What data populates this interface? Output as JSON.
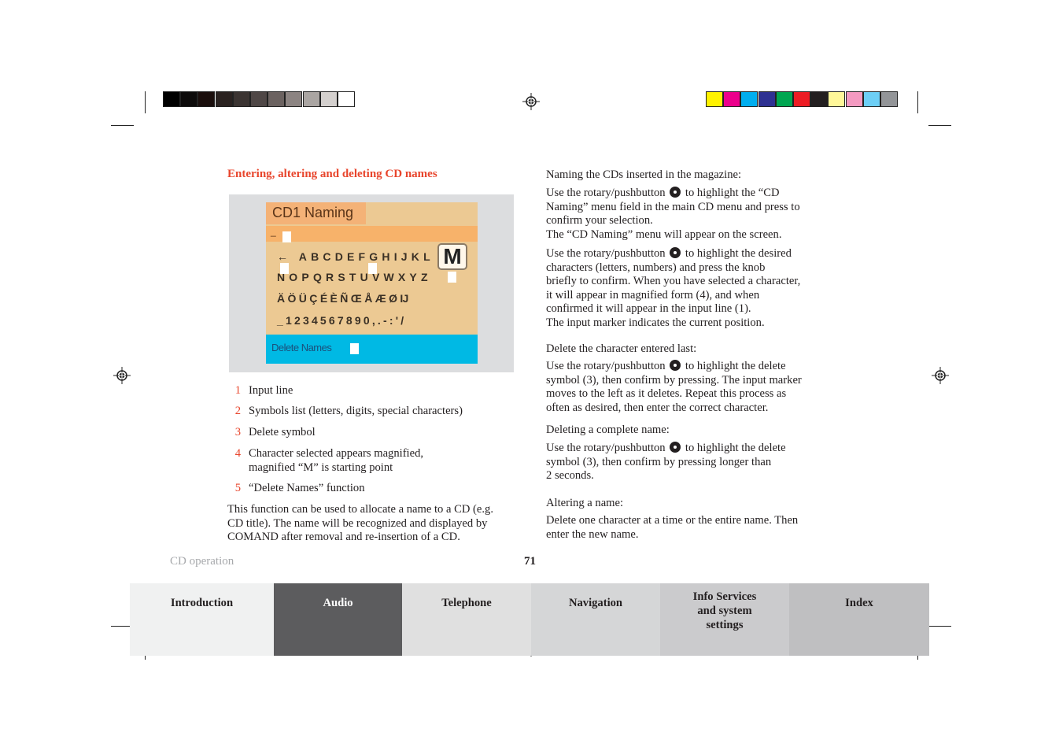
{
  "colors": {
    "accent": "#e8452c",
    "grayscale_bar": [
      "#000000",
      "#0d0b0b",
      "#1a0e0c",
      "#2a2220",
      "#3b3432",
      "#4f4746",
      "#6b6260",
      "#8c8482",
      "#aaa5a2",
      "#d4d0ce",
      "#ffffff"
    ],
    "color_bar": [
      "#fff200",
      "#ec008c",
      "#00aeef",
      "#2e3192",
      "#00a651",
      "#ed1c24",
      "#231f20",
      "#fff799",
      "#f49ac1",
      "#6dcff6",
      "#939598"
    ]
  },
  "left": {
    "heading": "Entering, altering and deleting CD names",
    "screen": {
      "title": "CD1 Naming",
      "input_line": "_",
      "row1": "← ABCDEFGHIJKL",
      "magnified": "M",
      "row2": "NOPQRSTUVWXYZ",
      "row3": "ÄÖÜÇÉÈÑŒÅÆØĲ",
      "row4": "_1234567890,.-:'/",
      "delete": "Delete Names"
    },
    "legend": [
      {
        "num": "1",
        "lines": [
          "Input line"
        ]
      },
      {
        "num": "2",
        "lines": [
          "Symbols list (letters, digits, special characters)"
        ]
      },
      {
        "num": "3",
        "lines": [
          "Delete symbol"
        ]
      },
      {
        "num": "4",
        "lines": [
          "Character selected appears magnified,",
          "magnified “M” is starting point"
        ]
      },
      {
        "num": "5",
        "lines": [
          "“Delete Names” function"
        ]
      }
    ],
    "paragraph": [
      "This function can be used to allocate a name to a CD (e.g.",
      "CD title). The name will be recognized and displayed by",
      "COMAND after removal and re-insertion of a CD."
    ]
  },
  "right": {
    "p1": "Naming the CDs inserted in the magazine:",
    "b1": {
      "pre": "Use the rotary/pushbutton",
      "post": "to highlight the “CD",
      "lines": [
        "Naming” menu field in the main CD menu and press to",
        "confirm your selection.",
        "The “CD Naming” menu will appear on the screen."
      ]
    },
    "b2": {
      "pre": "Use the rotary/pushbutton",
      "post": "to highlight the desired",
      "lines": [
        "characters (letters, numbers) and press the knob",
        "briefly to confirm. When you have selected a character,",
        "it will appear in magnified form (4), and when",
        "confirmed it will appear in the input line (1).",
        "The input marker indicates the current position."
      ]
    },
    "p2": "Delete the character entered last:",
    "b3": {
      "pre": "Use the rotary/pushbutton",
      "post": "to highlight the delete",
      "lines": [
        "symbol (3), then confirm by pressing. The input marker",
        "moves to the left as it deletes. Repeat this process as",
        "often as desired, then enter the correct character."
      ]
    },
    "p3": "Deleting a complete name:",
    "b4": {
      "pre": "Use the rotary/pushbutton",
      "post": "to highlight the delete",
      "lines": [
        "symbol (3), then confirm by pressing longer than",
        "2 seconds."
      ]
    },
    "p4": "Altering a name:",
    "b5": [
      "Delete one character at a time or the entire name. Then",
      "enter the new name."
    ]
  },
  "footer": {
    "section": "CD operation",
    "page": "71"
  },
  "tabs": [
    {
      "label": "Introduction",
      "bg": "#f0f1f1",
      "fg": "#231f20"
    },
    {
      "label": "Audio",
      "bg": "#5c5c5e",
      "fg": "#ffffff"
    },
    {
      "label": "Telephone",
      "bg": "#e0e0e0",
      "fg": "#231f20"
    },
    {
      "label": "Navigation",
      "bg": "#d5d6d7",
      "fg": "#231f20"
    },
    {
      "label": "Info Services and system settings",
      "bg": "#cbcbcd",
      "fg": "#231f20"
    },
    {
      "label": "Index",
      "bg": "#bfbfc1",
      "fg": "#231f20"
    }
  ]
}
